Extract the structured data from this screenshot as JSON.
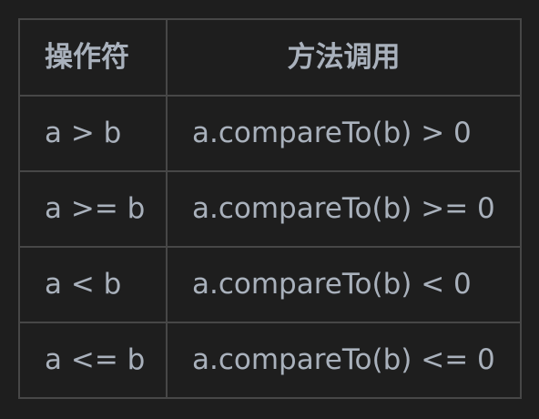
{
  "table": {
    "headers": [
      "操作符",
      "方法调用"
    ],
    "rows": [
      [
        "a > b",
        "a.compareTo(b) > 0"
      ],
      [
        "a >= b",
        "a.compareTo(b) >= 0"
      ],
      [
        "a < b",
        "a.compareTo(b) < 0"
      ],
      [
        "a <= b",
        "a.compareTo(b) <= 0"
      ]
    ]
  },
  "colors": {
    "background": "#1e1e1e",
    "border": "#474747",
    "text": "#a9b1bc"
  }
}
